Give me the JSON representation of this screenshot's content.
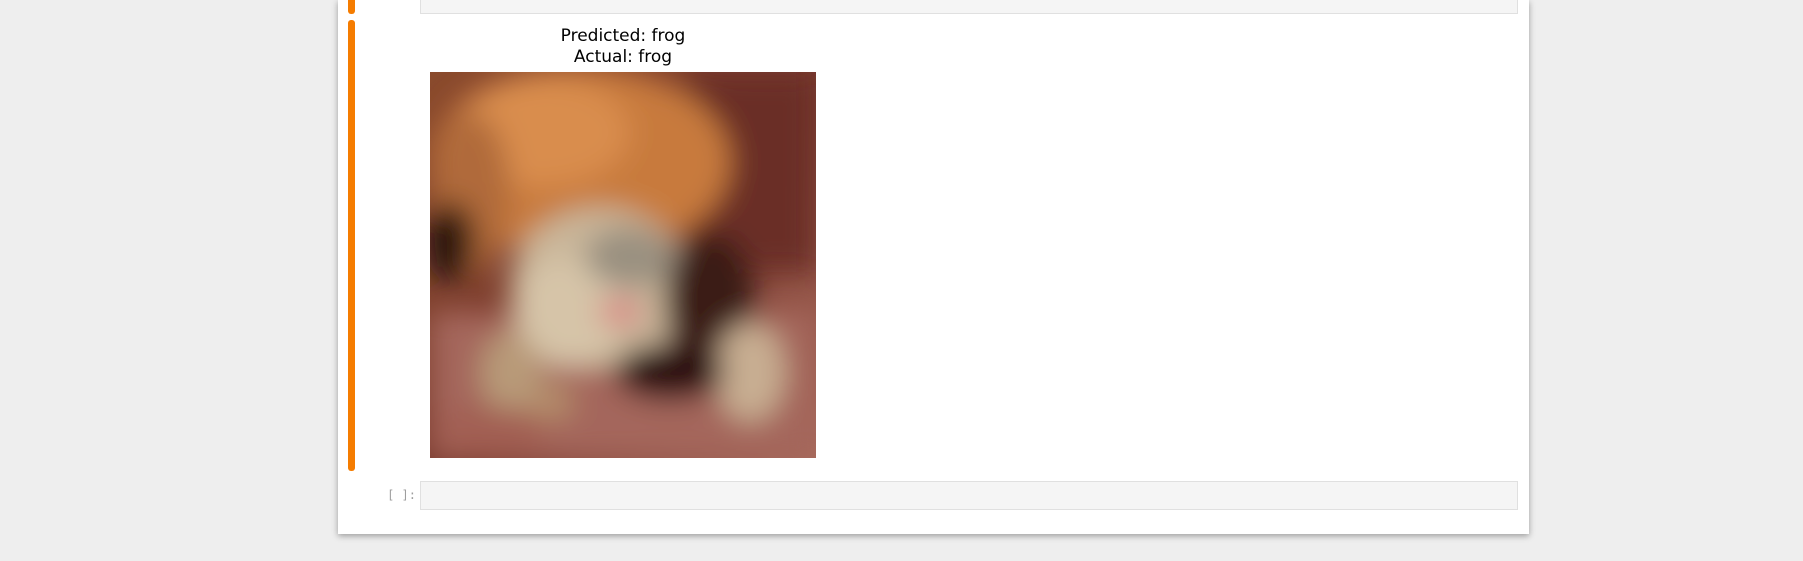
{
  "output_cell": {
    "title_line1": "Predicted: frog",
    "title_line2": "Actual: frog"
  },
  "empty_cell": {
    "prompt": "[ ]:",
    "value": ""
  },
  "colors": {
    "page_background": "#eeeeee",
    "notebook_background": "#ffffff",
    "active_cell_bar": "#f57c00",
    "input_area_background": "#f5f5f5",
    "prompt_text": "#9e9e9e"
  }
}
